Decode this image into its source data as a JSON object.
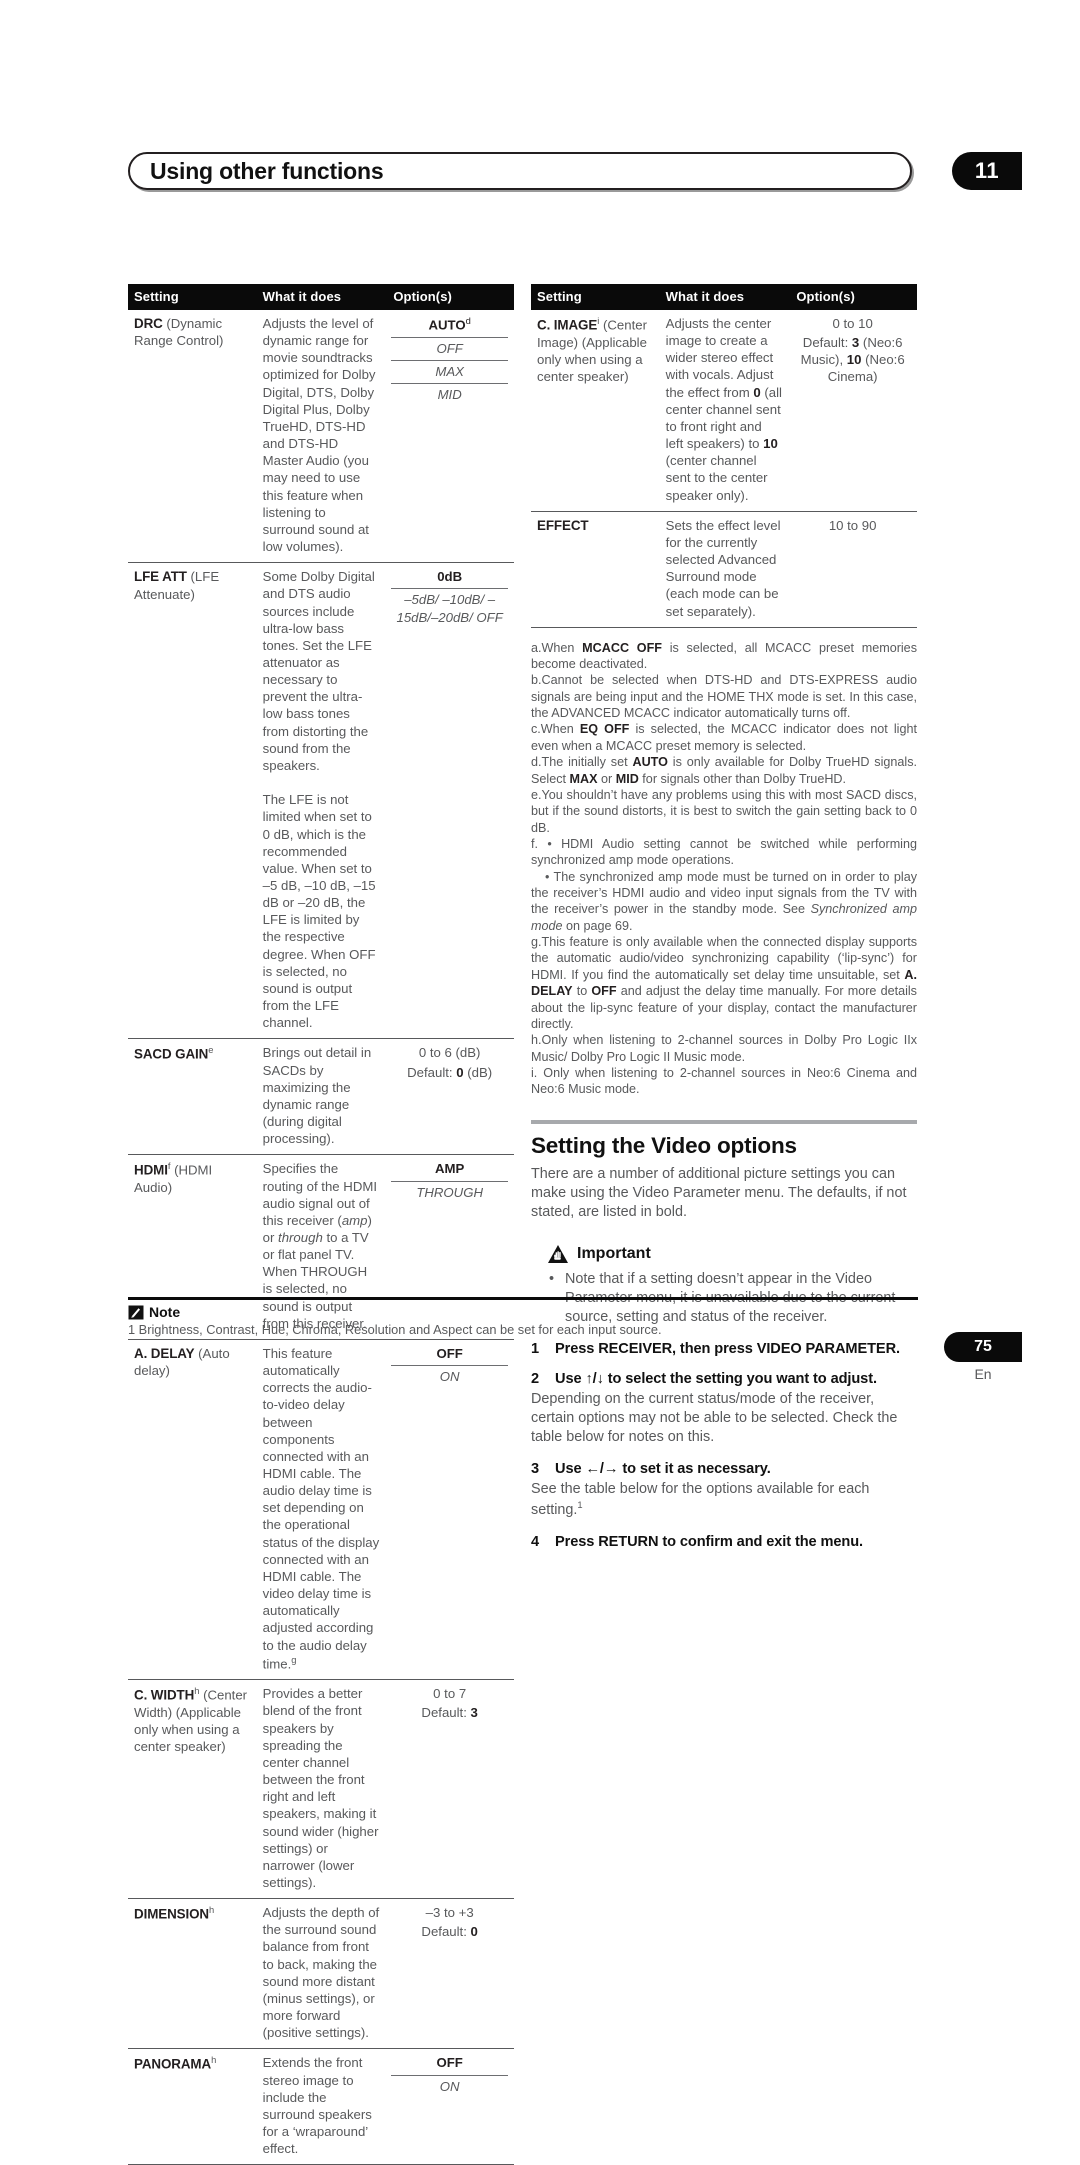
{
  "header": {
    "title": "Using other functions",
    "chapter": "11"
  },
  "table_left": {
    "columns": [
      "Setting",
      "What it does",
      "Option(s)"
    ],
    "rows": [
      {
        "name": "DRC",
        "name_sup": "",
        "sub": "(Dynamic Range Control)",
        "what": "Adjusts the level of dynamic range for movie soundtracks optimized for Dolby Digital, DTS, Dolby Digital Plus, Dolby TrueHD, DTS-HD and DTS-HD Master Audio (you may need to use this feature when listening to surround sound at low volumes).",
        "options": [
          "AUTO",
          "OFF",
          "MAX",
          "MID"
        ],
        "options_sup": "d"
      },
      {
        "name": "LFE ATT",
        "name_sup": "",
        "sub": "(LFE Attenuate)",
        "what": "Some Dolby Digital and DTS audio sources include ultra-low bass tones. Set the LFE attenuator as necessary to prevent the ultra-low bass tones from distorting the sound from the speakers.",
        "what2": "The LFE is not limited when set to 0 dB, which is the recommended value. When set to –5 dB, –10 dB, –15 dB or –20 dB, the LFE is limited by the respective degree. When OFF is selected, no sound is output from the LFE channel.",
        "options": [
          "0dB",
          "–5dB/ –10dB/ –15dB/–20dB/ OFF"
        ],
        "options_sup": ""
      },
      {
        "name": "SACD GAIN",
        "name_sup": "e",
        "sub": "",
        "what": "Brings out detail in SACDs by maximizing the dynamic range (during digital processing).",
        "opt_range": "0 to 6 (dB)",
        "opt_default_pre": "Default: ",
        "opt_default_val": "0",
        "opt_default_post": " (dB)"
      },
      {
        "name": "HDMI",
        "name_sup": "f",
        "sub": "(HDMI Audio)",
        "what_a": "Specifies the routing of the HDMI audio signal out of this receiver (",
        "what_i1": "amp",
        "what_b": ") or ",
        "what_i2": "through",
        "what_c": " to a TV or flat panel TV. When THROUGH is selected, no sound is output from this receiver.",
        "options": [
          "AMP",
          "THROUGH"
        ]
      },
      {
        "name": "A. DELAY",
        "name_sup": "",
        "sub": "(Auto delay)",
        "what": "This feature automatically corrects the audio-to-video delay between components connected with an HDMI cable. The audio delay time is set depending on the operational status of the display connected with an HDMI cable. The video delay time is automatically adjusted according to the audio delay time.",
        "what_sup": "g",
        "options": [
          "OFF",
          "ON"
        ]
      },
      {
        "name": "C. WIDTH",
        "name_sup": "h",
        "sub": "(Center Width) (Applicable only when using a center speaker)",
        "what": "Provides a better blend of the front speakers by spreading the center channel between the front right and left speakers, making it sound wider (higher settings) or narrower (lower settings).",
        "opt_range": "0 to 7",
        "opt_default_pre": "Default: ",
        "opt_default_val": "3",
        "opt_default_post": ""
      },
      {
        "name": "DIMENSION",
        "name_sup": "h",
        "sub": "",
        "what": "Adjusts the depth of the surround sound balance from front to back, making the sound more distant (minus settings), or more forward (positive settings).",
        "opt_range": "–3 to +3",
        "opt_default_pre": "Default: ",
        "opt_default_val": "0",
        "opt_default_post": ""
      },
      {
        "name": "PANORAMA",
        "name_sup": "h",
        "sub": "",
        "what": "Extends the front stereo image to include the surround speakers for a ‘wraparound’ effect.",
        "options": [
          "OFF",
          "ON"
        ]
      }
    ]
  },
  "table_right": {
    "columns": [
      "Setting",
      "What it does",
      "Option(s)"
    ],
    "rows": [
      {
        "name": "C. IMAGE",
        "name_sup": "i",
        "sub": "(Center Image) (Applicable only when using a center speaker)",
        "what_a": "Adjusts the center image to create a wider stereo effect with vocals. Adjust the effect from ",
        "what_b0": "0",
        "what_c": " (all center channel sent to front right and left speakers) to ",
        "what_b10": "10",
        "what_d": " (center channel sent to the center speaker only).",
        "opt_range": "0 to 10",
        "opt_default_pre": "Default: ",
        "opt_default_val": "3",
        "opt_default_post": " (Neo:6 Music), ",
        "opt_default_val2": "10",
        "opt_default_post2": " (Neo:6 Cinema)"
      },
      {
        "name": "EFFECT",
        "name_sup": "",
        "sub": "",
        "what": "Sets the effect level for the currently selected Advanced Surround mode (each mode can be set separately).",
        "opt_range": "10 to 90"
      }
    ]
  },
  "footnotes": [
    {
      "label": "a.",
      "parts": [
        {
          "t": "When "
        },
        {
          "t": "MCACC OFF",
          "b": true
        },
        {
          "t": " is selected, all MCACC preset memories become deactivated."
        }
      ]
    },
    {
      "label": "b.",
      "parts": [
        {
          "t": "Cannot be selected when DTS-HD and DTS-EXPRESS audio signals are being input and the HOME THX mode is set. In this case, the ADVANCED MCACC indicator automatically turns off."
        }
      ]
    },
    {
      "label": "c.",
      "parts": [
        {
          "t": "When "
        },
        {
          "t": "EQ OFF",
          "b": true
        },
        {
          "t": " is selected, the MCACC indicator does not light even when a MCACC preset memory is selected."
        }
      ]
    },
    {
      "label": "d.",
      "parts": [
        {
          "t": "The initially set "
        },
        {
          "t": "AUTO",
          "b": true
        },
        {
          "t": " is only available for Dolby TrueHD signals. Select "
        },
        {
          "t": "MAX",
          "b": true
        },
        {
          "t": " or "
        },
        {
          "t": "MID",
          "b": true
        },
        {
          "t": " for signals other than Dolby TrueHD."
        }
      ]
    },
    {
      "label": "e.",
      "parts": [
        {
          "t": "You shouldn’t have any problems using this with most SACD discs, but if the sound distorts, it is best to switch the gain setting back to 0 dB."
        }
      ]
    },
    {
      "label": "f.",
      "parts": [
        {
          "t": " • HDMI Audio setting cannot be switched while performing synchronized amp mode operations."
        }
      ]
    },
    {
      "label": "",
      "indent": true,
      "parts": [
        {
          "t": "• The synchronized amp mode must be turned on in order to play the receiver’s HDMI audio and video input signals from the TV with the receiver’s power in the standby mode. See "
        },
        {
          "t": "Synchronized amp mode",
          "i": true
        },
        {
          "t": " on page 69."
        }
      ]
    },
    {
      "label": "g.",
      "parts": [
        {
          "t": "This feature is only available when the connected display supports the automatic audio/video synchronizing capability (‘lip-sync’) for HDMI. If you find the automatically set delay time unsuitable, set "
        },
        {
          "t": "A. DELAY",
          "b": true
        },
        {
          "t": " to "
        },
        {
          "t": "OFF",
          "b": true
        },
        {
          "t": " and adjust the delay time manually. For more details about the lip-sync feature of your display, contact the manufacturer directly."
        }
      ]
    },
    {
      "label": "h.",
      "parts": [
        {
          "t": "Only when listening to 2-channel sources in Dolby Pro Logic IIx Music/ Dolby Pro Logic II Music mode."
        }
      ]
    },
    {
      "label": "i.",
      "parts": [
        {
          "t": " Only when listening to 2-channel sources in Neo:6 Cinema and Neo:6 Music mode."
        }
      ]
    }
  ],
  "video_section": {
    "title": "Setting the Video options",
    "intro": "There are a number of additional picture settings you can make using the Video Parameter menu. The defaults, if not stated, are listed in bold.",
    "important_label": "Important",
    "important_bullet": "Note that if a setting doesn’t appear in the Video Parameter menu, it is unavailable due to the current source, setting and status of the receiver.",
    "steps": [
      {
        "num": "1",
        "text": "Press RECEIVER, then press VIDEO PARAMETER.",
        "body": ""
      },
      {
        "num": "2",
        "text_a": "Use ",
        "arrows": "↑/↓",
        "text_b": " to select the setting you want to adjust.",
        "body": "Depending on the current status/mode of the receiver, certain options may not be able to be selected. Check the table below for notes on this."
      },
      {
        "num": "3",
        "text_a": "Use ",
        "arrows": "←/→",
        "text_b": " to set it as necessary.",
        "body": "See the table below for the options available for each setting.",
        "body_sup": "1"
      },
      {
        "num": "4",
        "text": "Press RETURN to confirm and exit the menu.",
        "body": ""
      }
    ]
  },
  "note_block": {
    "label": "Note",
    "items": [
      "1 Brightness, Contrast, Hue, Chroma, Resolution and Aspect can be set for each input source."
    ]
  },
  "footer": {
    "page": "75",
    "lang": "En"
  }
}
